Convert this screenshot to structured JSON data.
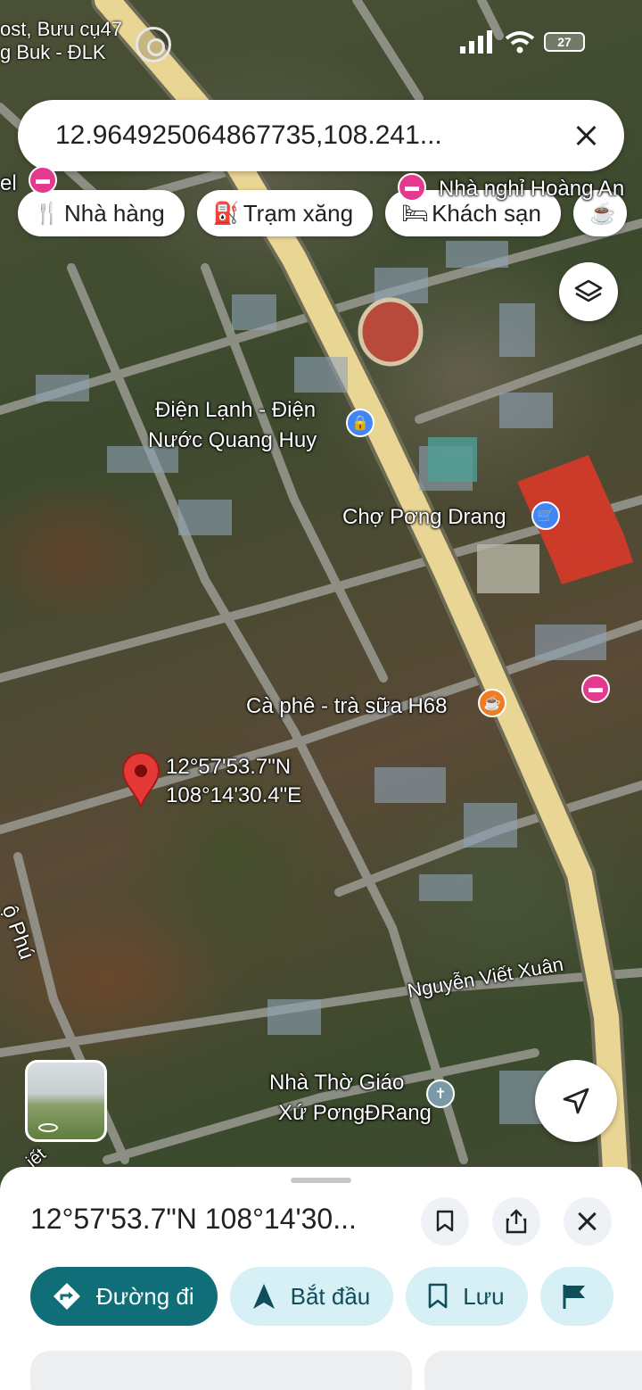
{
  "status_bar": {
    "left_line1": "ost, Bưu cụ47",
    "left_line2": "g Buk - ĐLK",
    "battery": "27"
  },
  "search": {
    "value": "12.964925064867735,108.241..."
  },
  "chips": [
    {
      "icon": "restaurant-icon",
      "label": "Nhà hàng"
    },
    {
      "icon": "gas-station-icon",
      "label": "Trạm xăng"
    },
    {
      "icon": "hotel-icon",
      "label": "Khách sạn"
    }
  ],
  "map": {
    "labels": {
      "hotel_partial_left": "el",
      "hotel_partial_top": "Nhà nghỉ Hoàng An",
      "shop1_line1": "Điện Lạnh - Điện",
      "shop1_line2": "Nước Quang Huy",
      "market": "Chợ Pơng Drang",
      "cafe": "Cà phê - trà sữa H68",
      "pin_lat": "12°57'53.7\"N",
      "pin_lng": "108°14'30.4\"E",
      "street": "Nguyễn Viết Xuân",
      "church_line1": "Nhà Thờ Giáo",
      "church_line2": "Xứ PơngĐRang",
      "road_left": "ộ Phú",
      "road_bottom_left": "iết"
    },
    "colors": {
      "main_road": "#e9d594",
      "pin": "#e53935",
      "hotel_poi": "#e33a8f",
      "shop_poi": "#4285f4",
      "cafe_poi": "#f07c22",
      "church_poi": "#7a9aa8"
    }
  },
  "sheet": {
    "title": "12°57'53.7\"N 108°14'30...",
    "actions": [
      {
        "icon": "directions-icon",
        "label": "Đường đi"
      },
      {
        "icon": "navigation-icon",
        "label": "Bắt đầu"
      },
      {
        "icon": "bookmark-icon",
        "label": "Lưu"
      }
    ]
  }
}
